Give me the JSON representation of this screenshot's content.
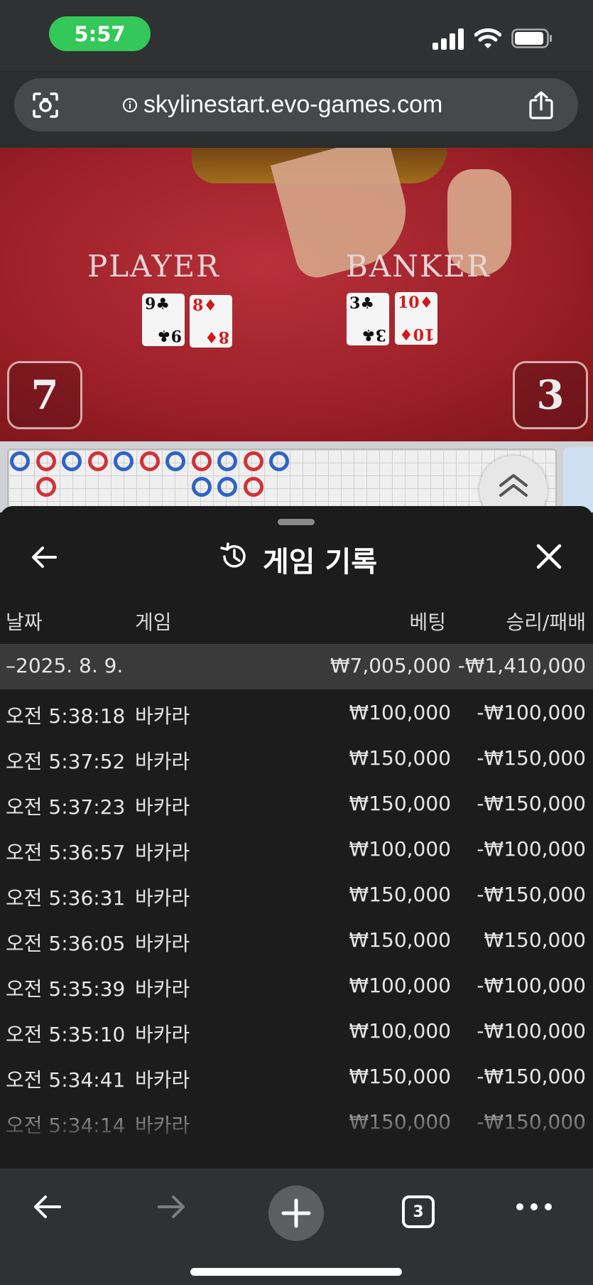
{
  "status_bar": {
    "time": "5:57"
  },
  "browser": {
    "url": "skylinestart.evo-games.com",
    "tabs_count": "3"
  },
  "table": {
    "player_label": "PLAYER",
    "banker_label": "BANKER",
    "player_score": "7",
    "banker_score": "3",
    "player_cards": [
      {
        "rank": "9",
        "suit": "♣",
        "color": "black"
      },
      {
        "rank": "8",
        "suit": "♦",
        "color": "red"
      }
    ],
    "banker_cards": [
      {
        "rank": "3",
        "suit": "♣",
        "color": "black"
      },
      {
        "rank": "10",
        "suit": "♦",
        "color": "red"
      }
    ]
  },
  "roadmap": {
    "colors": {
      "player": "#2e63c7",
      "banker": "#d0323a"
    },
    "top_row": [
      "B",
      "R",
      "B",
      "R",
      "B",
      "R",
      "B",
      "R",
      "B",
      "R",
      "B"
    ],
    "second_row": [
      "",
      "R",
      "",
      "",
      "",
      "",
      "",
      "B",
      "B",
      "R",
      ""
    ]
  },
  "history": {
    "title": "게임 기록",
    "columns": {
      "date": "날짜",
      "game": "게임",
      "bet": "베팅",
      "result": "승리/패배"
    },
    "group": {
      "date": "–2025. 8. 9.",
      "bet_total": "₩7,005,000",
      "result_total": "-₩1,410,000"
    },
    "rows": [
      {
        "time": "오전 5:38:18",
        "game": "바카라",
        "bet": "₩100,000",
        "result": "-₩100,000"
      },
      {
        "time": "오전 5:37:52",
        "game": "바카라",
        "bet": "₩150,000",
        "result": "-₩150,000"
      },
      {
        "time": "오전 5:37:23",
        "game": "바카라",
        "bet": "₩150,000",
        "result": "-₩150,000"
      },
      {
        "time": "오전 5:36:57",
        "game": "바카라",
        "bet": "₩100,000",
        "result": "-₩100,000"
      },
      {
        "time": "오전 5:36:31",
        "game": "바카라",
        "bet": "₩150,000",
        "result": "-₩150,000"
      },
      {
        "time": "오전 5:36:05",
        "game": "바카라",
        "bet": "₩150,000",
        "result": "₩150,000"
      },
      {
        "time": "오전 5:35:39",
        "game": "바카라",
        "bet": "₩100,000",
        "result": "-₩100,000"
      },
      {
        "time": "오전 5:35:10",
        "game": "바카라",
        "bet": "₩100,000",
        "result": "-₩100,000"
      },
      {
        "time": "오전 5:34:41",
        "game": "바카라",
        "bet": "₩150,000",
        "result": "-₩150,000"
      },
      {
        "time": "오전 5:34:14",
        "game": "바카라",
        "bet": "₩150,000",
        "result": "-₩150,000"
      }
    ]
  }
}
